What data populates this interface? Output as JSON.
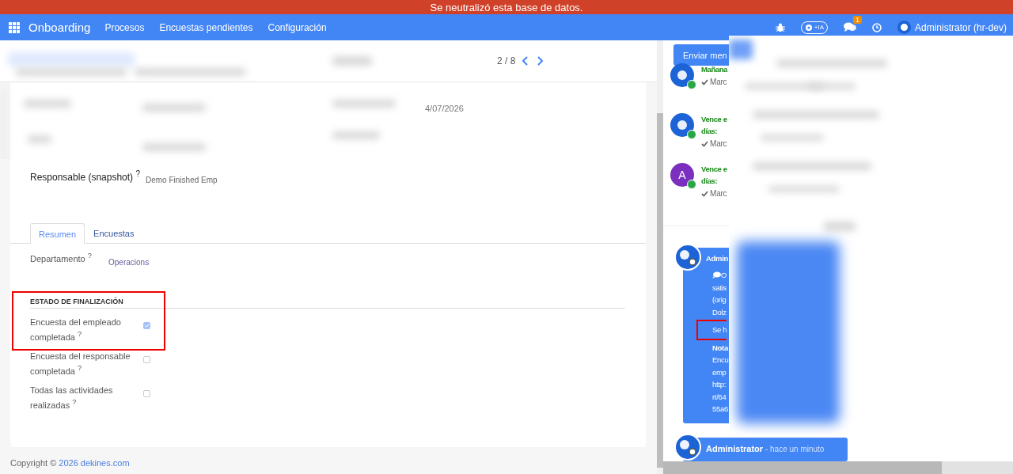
{
  "banner": {
    "text": "Se neutralizó esta base de datos."
  },
  "navbar": {
    "app": "Onboarding",
    "menus": [
      "Procesos",
      "Encuestas pendientes",
      "Configuración"
    ],
    "ai_label": "+IA",
    "messages_badge": "1",
    "user": "Administrator (hr-dev)"
  },
  "pager": {
    "text": "2 / 8"
  },
  "form": {
    "date_fragment": "4/07/2026",
    "responsible": {
      "label": "Responsable (snapshot) $^{?}$",
      "value": "Demo Finished Emp"
    },
    "tabs": [
      {
        "label": "Resumen",
        "selected": true
      },
      {
        "label": "Encuestas",
        "selected": false
      }
    ],
    "department": {
      "label": "Departamento $^{?}$",
      "value": "Operacions"
    },
    "section": {
      "title": "ESTADO DE FINALIZACIÓN",
      "highlighted": true
    },
    "checks": [
      {
        "label": "Encuesta del empleado completada $^{?}$",
        "checked": true
      },
      {
        "label": "Encuesta del responsable completada $^{?}$",
        "checked": false
      },
      {
        "label": "Todas las actividades realizadas $^{?}$",
        "checked": false
      }
    ]
  },
  "footer": {
    "prefix": "Copyright © ",
    "link": "2026 dekines.com"
  },
  "chatter": {
    "send_button": "Enviar men",
    "activities": [
      {
        "kind": "logo",
        "title_lines": [
          "Mañana"
        ],
        "done": "Marc"
      },
      {
        "kind": "logo",
        "title_lines": [
          "Vence e",
          "días:"
        ],
        "done": "Marc"
      },
      {
        "kind": "letter",
        "letter": "A",
        "title_lines": [
          "Vence e",
          "días:"
        ],
        "done": "Marc"
      }
    ],
    "messages": [
      {
        "author": "Admin",
        "lines": [
          {
            "kind": "comment",
            "text": "O",
            "bold": false,
            "highlighted": false
          },
          {
            "kind": "text",
            "text": "satis",
            "bold": false,
            "highlighted": false
          },
          {
            "kind": "text",
            "text": "(orig",
            "bold": false,
            "highlighted": false
          },
          {
            "kind": "text",
            "text": "Dolz",
            "bold": false,
            "highlighted": false
          },
          {
            "kind": "text",
            "text": "Se h",
            "bold": false,
            "highlighted": true
          },
          {
            "kind": "text",
            "text": "Nota",
            "bold": true,
            "highlighted": false
          },
          {
            "kind": "text",
            "text": "Encu",
            "bold": false,
            "highlighted": false
          },
          {
            "kind": "text",
            "text": "emp",
            "bold": false,
            "highlighted": false
          },
          {
            "kind": "text",
            "text": "http:",
            "bold": false,
            "highlighted": false
          },
          {
            "kind": "text",
            "text": "rt/64",
            "bold": false,
            "highlighted": false
          },
          {
            "kind": "text",
            "text": "55a6",
            "bold": false,
            "highlighted": false
          }
        ]
      },
      {
        "author": "Administrator",
        "time": " - hace un minuto"
      }
    ]
  }
}
